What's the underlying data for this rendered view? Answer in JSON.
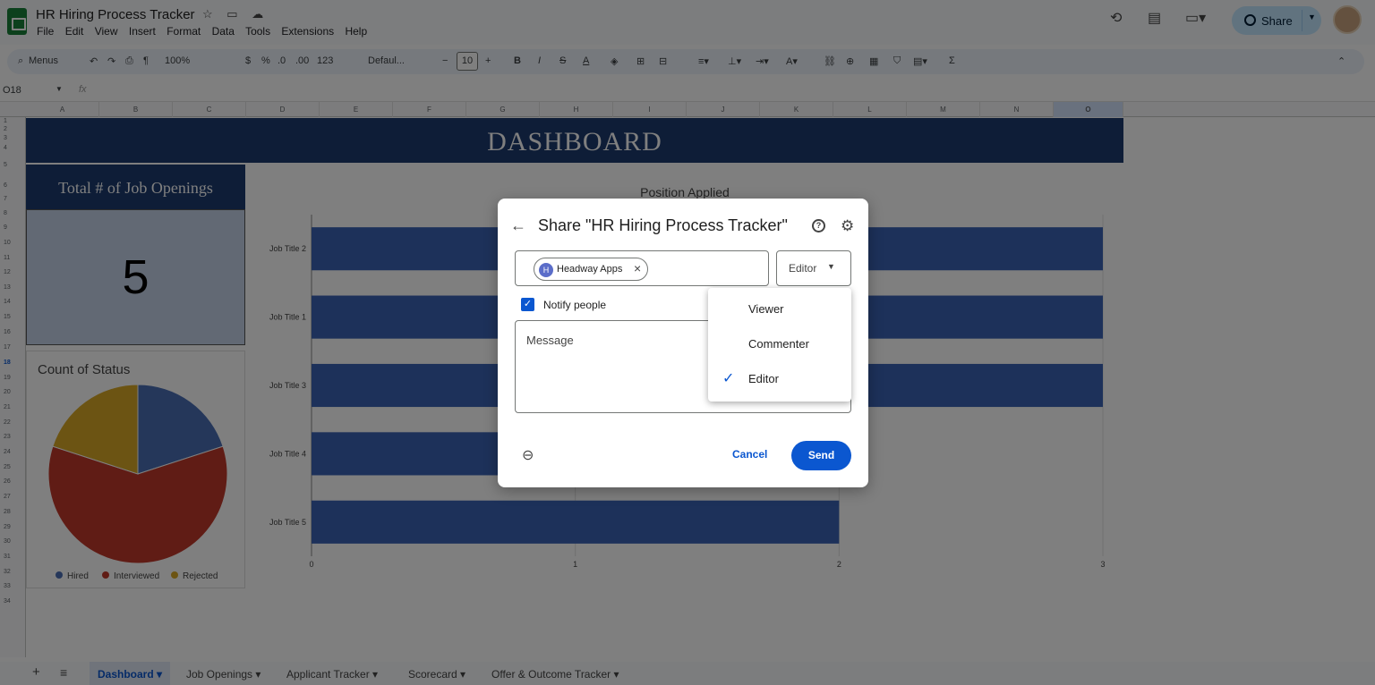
{
  "app": {
    "title": "HR Hiring Process Tracker",
    "menus": [
      "File",
      "Edit",
      "View",
      "Insert",
      "Format",
      "Data",
      "Tools",
      "Extensions",
      "Help"
    ],
    "share_label": "Share"
  },
  "toolbar": {
    "menus_label": "Menus",
    "zoom": "100%",
    "currency": "$",
    "percent": "%",
    "dec_less": ".0",
    "dec_more": ".00",
    "num_format": "123",
    "font": "Defaul...",
    "font_size": "10",
    "bold": "B",
    "italic": "I",
    "strike": "S",
    "text_color": "A",
    "sum": "Σ"
  },
  "formula_bar": {
    "cell_ref": "O18",
    "fx": "fx"
  },
  "columns": [
    "A",
    "B",
    "C",
    "D",
    "E",
    "F",
    "G",
    "H",
    "I",
    "J",
    "K",
    "L",
    "M",
    "N",
    "O"
  ],
  "rows": [
    "1",
    "2",
    "3",
    "4",
    "5",
    "6",
    "7",
    "8",
    "9",
    "10",
    "11",
    "12",
    "13",
    "14",
    "15",
    "16",
    "17",
    "18",
    "19",
    "20",
    "21",
    "22",
    "23",
    "24",
    "25",
    "26",
    "27",
    "28",
    "29",
    "30",
    "31",
    "32",
    "33",
    "34"
  ],
  "dashboard": {
    "title": "DASHBOARD",
    "openings_header": "Total # of Job Openings",
    "openings_value": "5"
  },
  "chart_data": [
    {
      "type": "pie",
      "title": "Count of Status",
      "categories": [
        "Hired",
        "Interviewed",
        "Rejected"
      ],
      "values": [
        1,
        3,
        1
      ],
      "colors": [
        "#4a6fb5",
        "#c0392b",
        "#d9a827"
      ],
      "legend": "bottom"
    },
    {
      "type": "bar",
      "orientation": "horizontal",
      "title": "Position Applied",
      "categories": [
        "Job Title 2",
        "Job Title 1",
        "Job Title 3",
        "Job Title 4",
        "Job Title 5"
      ],
      "values": [
        3,
        3,
        3,
        2,
        2
      ],
      "xlim": [
        0,
        3
      ],
      "xticks": [
        "0",
        "1",
        "2",
        "3"
      ],
      "color": "#3b63b5",
      "grid": true
    }
  ],
  "sheet_tabs": [
    "Dashboard",
    "Job Openings",
    "Applicant Tracker",
    "Scorecard",
    "Offer & Outcome Tracker"
  ],
  "dialog": {
    "title": "Share \"HR Hiring Process Tracker\"",
    "help": "?",
    "recipient": {
      "initial": "H",
      "name": "Headway Apps"
    },
    "role": "Editor",
    "notify_label": "Notify people",
    "notify_checked": true,
    "message_placeholder": "Message",
    "cancel": "Cancel",
    "send": "Send",
    "role_menu": [
      {
        "label": "Viewer",
        "selected": false
      },
      {
        "label": "Commenter",
        "selected": false
      },
      {
        "label": "Editor",
        "selected": true
      }
    ]
  }
}
